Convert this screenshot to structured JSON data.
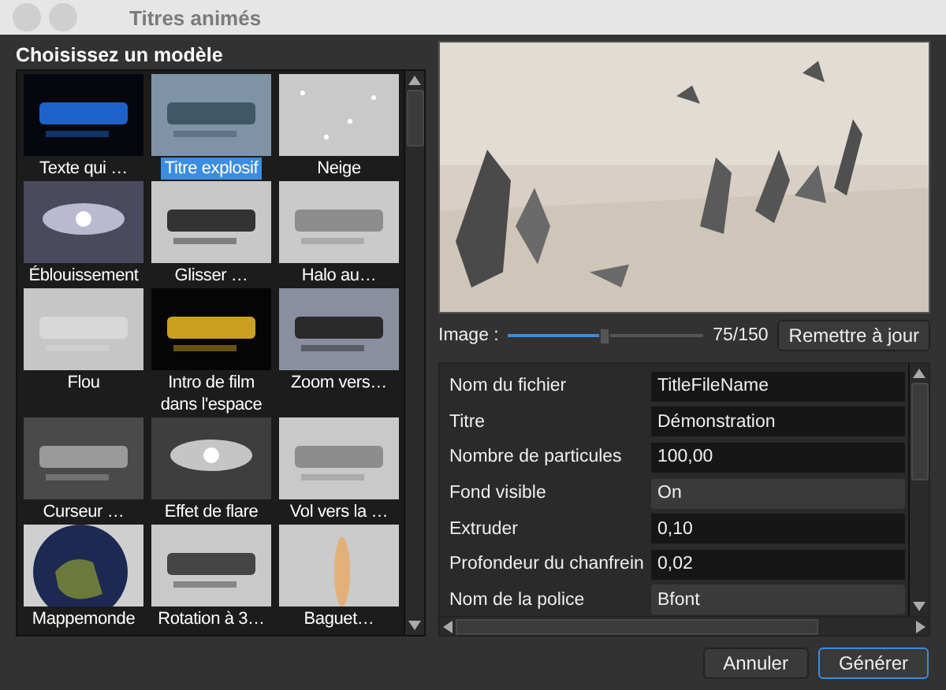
{
  "window": {
    "title": "Titres animés"
  },
  "templates": {
    "heading": "Choisissez un modèle",
    "items": [
      {
        "label": "Texte qui …",
        "selected": false
      },
      {
        "label": "Titre explosif",
        "selected": true
      },
      {
        "label": "Neige",
        "selected": false
      },
      {
        "label": "Éblouissement",
        "selected": false
      },
      {
        "label": "Glisser …",
        "selected": false
      },
      {
        "label": "Halo au…",
        "selected": false
      },
      {
        "label": "Flou",
        "selected": false
      },
      {
        "label": "Intro de film dans l'espace",
        "selected": false
      },
      {
        "label": "Zoom vers…",
        "selected": false
      },
      {
        "label": "Curseur …",
        "selected": false
      },
      {
        "label": "Effet de flare",
        "selected": false
      },
      {
        "label": "Vol vers la …",
        "selected": false
      },
      {
        "label": "Mappemonde",
        "selected": false
      },
      {
        "label": "Rotation à 3…",
        "selected": false
      },
      {
        "label": "Baguet…",
        "selected": false
      }
    ]
  },
  "frame": {
    "label": "Image :",
    "level": 0.5,
    "reading": "75/150",
    "button": "Remettre à jour"
  },
  "properties": [
    {
      "name": "Nom du fichier",
      "value": "TitleFileName",
      "kind": "text"
    },
    {
      "name": "Titre",
      "value": "Démonstration",
      "kind": "text"
    },
    {
      "name": "Nombre de particules",
      "value": "100,00",
      "kind": "text"
    },
    {
      "name": "Fond visible",
      "value": "On",
      "kind": "select"
    },
    {
      "name": "Extruder",
      "value": "0,10",
      "kind": "text"
    },
    {
      "name": "Profondeur du chanfrein",
      "value": "0,02",
      "kind": "text"
    },
    {
      "name": "Nom de la police",
      "value": "Bfont",
      "kind": "select"
    }
  ],
  "buttons": [
    {
      "label": "Annuler",
      "default": false
    },
    {
      "label": "Générer",
      "default": true
    }
  ]
}
